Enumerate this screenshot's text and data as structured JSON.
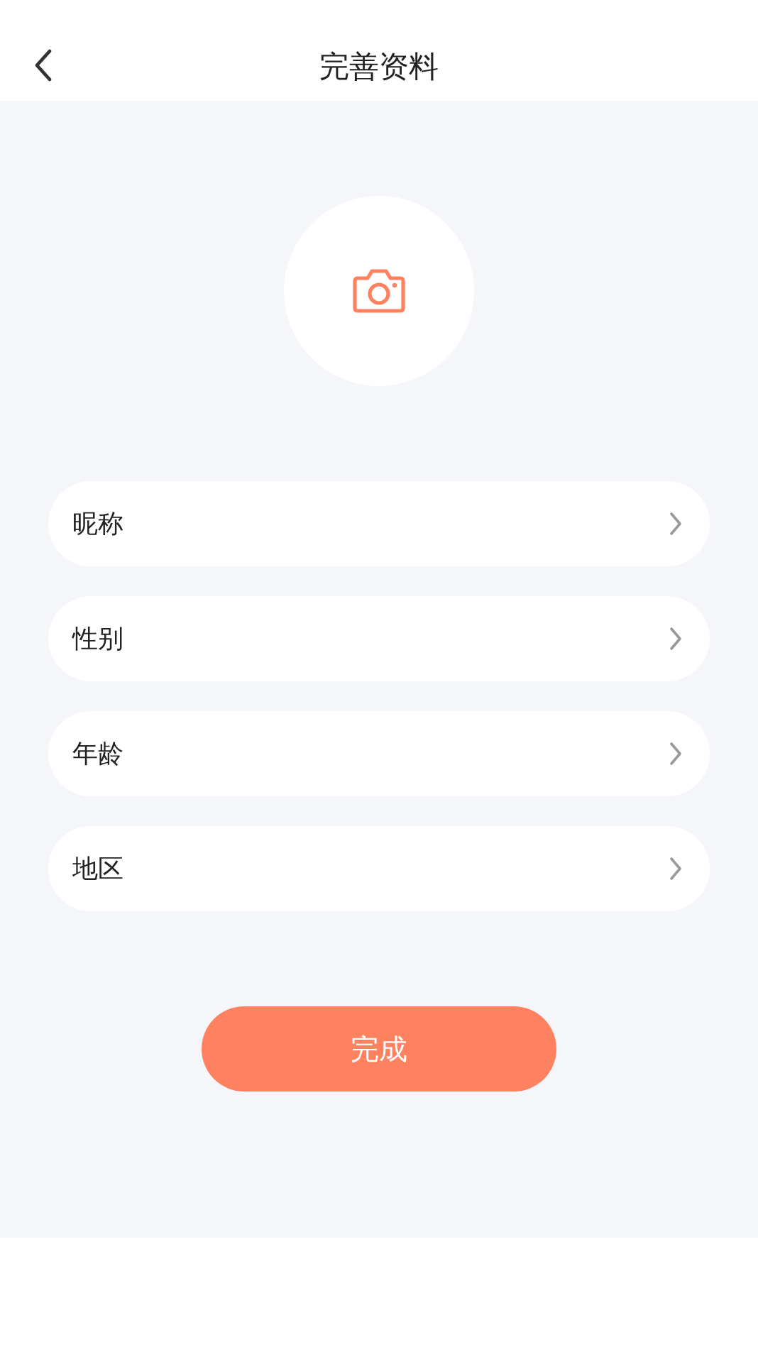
{
  "header": {
    "title": "完善资料"
  },
  "fields": [
    {
      "label": "昵称"
    },
    {
      "label": "性别"
    },
    {
      "label": "年龄"
    },
    {
      "label": "地区"
    }
  ],
  "submit": {
    "label": "完成"
  }
}
